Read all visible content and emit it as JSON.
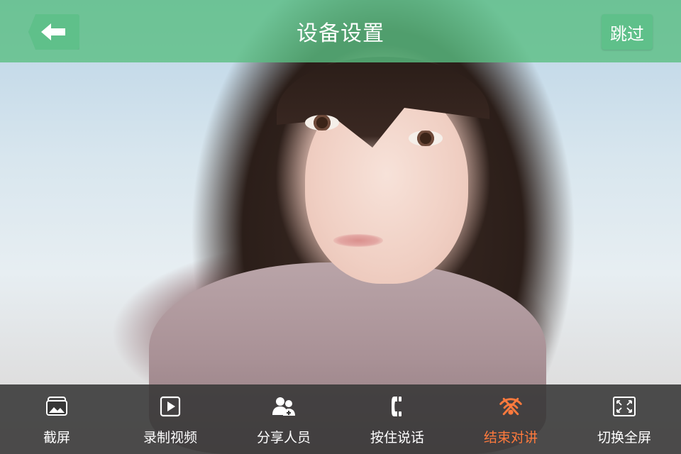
{
  "header": {
    "title": "设备设置",
    "skip_label": "跳过",
    "back_icon": "arrow-left-icon"
  },
  "toolbar": {
    "items": [
      {
        "label": "截屏",
        "icon": "screenshot-icon"
      },
      {
        "label": "录制视频",
        "icon": "record-video-icon"
      },
      {
        "label": "分享人员",
        "icon": "share-people-icon"
      },
      {
        "label": "按住说话",
        "icon": "push-to-talk-icon"
      },
      {
        "label": "结束对讲",
        "icon": "end-intercom-icon",
        "active": true
      },
      {
        "label": "切换全屏",
        "icon": "fullscreen-icon"
      }
    ]
  },
  "colors": {
    "header_bg": "#5abe82",
    "button_bg": "#5fc08a",
    "toolbar_bg": "#373737",
    "active": "#ff7a3d",
    "text": "#ffffff"
  }
}
